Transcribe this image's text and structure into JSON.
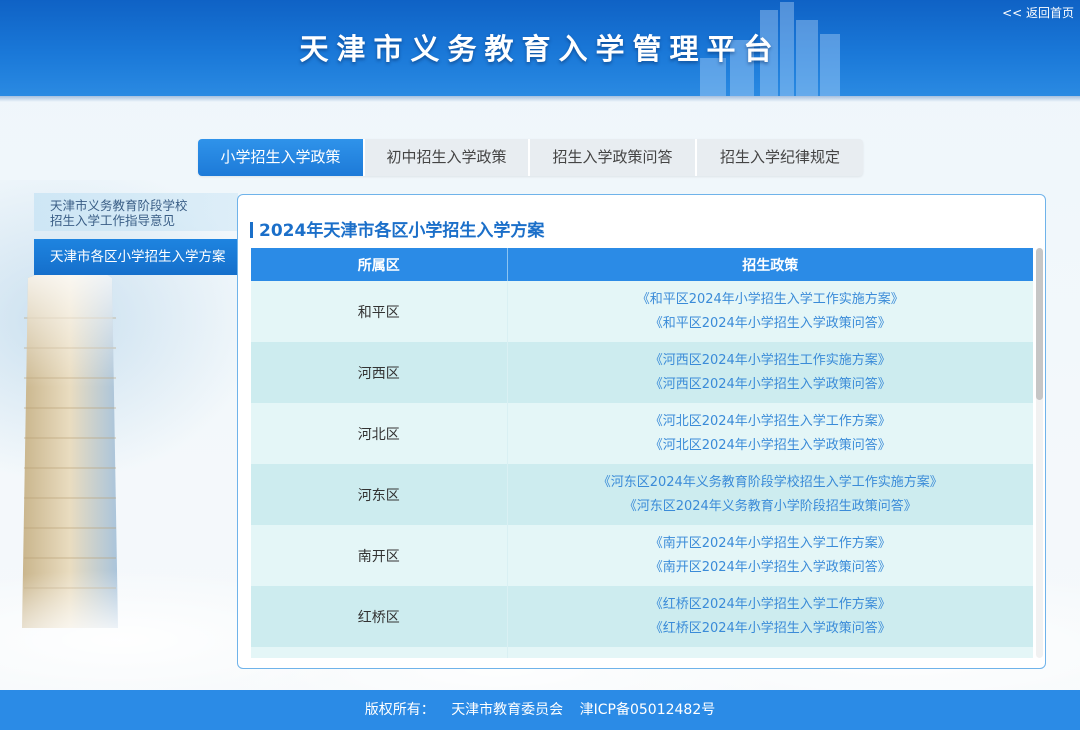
{
  "header": {
    "title": "天津市义务教育入学管理平台",
    "back_home": "<< 返回首页"
  },
  "tabs": [
    {
      "label": "小学招生入学政策",
      "active": true
    },
    {
      "label": "初中招生入学政策",
      "active": false
    },
    {
      "label": "招生入学政策问答",
      "active": false
    },
    {
      "label": "招生入学纪律规定",
      "active": false
    }
  ],
  "sidebar": {
    "items": [
      {
        "label_line1": "天津市义务教育阶段学校",
        "label_line2": "招生入学工作指导意见",
        "active": false
      },
      {
        "label": "天津市各区小学招生入学方案",
        "active": true
      }
    ]
  },
  "content": {
    "title": "2024年天津市各区小学招生入学方案",
    "table": {
      "headers": [
        "所属区",
        "招生政策"
      ],
      "rows": [
        {
          "district": "和平区",
          "links": [
            "《和平区2024年小学招生入学工作实施方案》",
            "《和平区2024年小学招生入学政策问答》"
          ]
        },
        {
          "district": "河西区",
          "links": [
            "《河西区2024年小学招生工作实施方案》",
            "《河西区2024年小学招生入学政策问答》"
          ]
        },
        {
          "district": "河北区",
          "links": [
            "《河北区2024年小学招生入学工作方案》",
            "《河北区2024年小学招生入学政策问答》"
          ]
        },
        {
          "district": "河东区",
          "links": [
            "《河东区2024年义务教育阶段学校招生入学工作实施方案》",
            "《河东区2024年义务教育小学阶段招生政策问答》"
          ]
        },
        {
          "district": "南开区",
          "links": [
            "《南开区2024年小学招生入学工作方案》",
            "《南开区2024年小学招生入学政策问答》"
          ]
        },
        {
          "district": "红桥区",
          "links": [
            "《红桥区2024年小学招生入学工作方案》",
            "《红桥区2024年小学招生入学政策问答》"
          ]
        }
      ]
    }
  },
  "footer": {
    "copyright_label": "版权所有：",
    "owner": "天津市教育委员会",
    "icp": "津ICP备05012482号"
  },
  "colors": {
    "header_blue": "#1a78d8",
    "accent_blue": "#2b8be6",
    "link_blue": "#3a8bd8"
  }
}
